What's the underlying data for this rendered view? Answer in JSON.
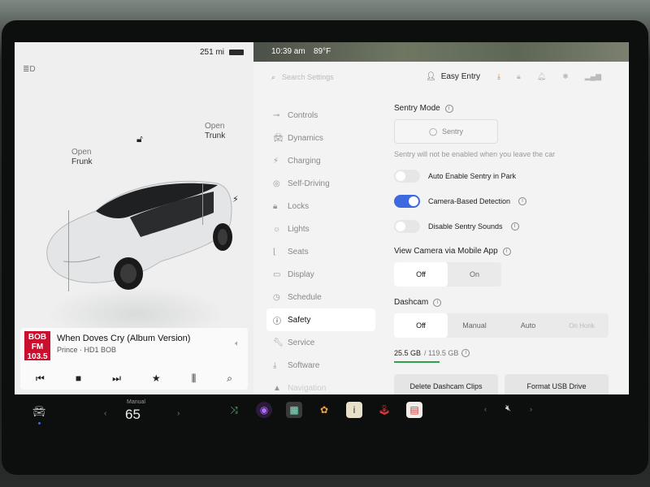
{
  "car": {
    "range": "251 mi",
    "frunk_open": "Open",
    "frunk_label": "Frunk",
    "trunk_open": "Open",
    "trunk_label": "Trunk"
  },
  "media": {
    "station_logo": "BOB FM 103.5",
    "song": "When Doves Cry (Album Version)",
    "artist": "Prince · HD1 BOB"
  },
  "status": {
    "time": "10:39 am",
    "temperature": "89°F"
  },
  "header": {
    "search_placeholder": "Search Settings",
    "profile": "Easy Entry"
  },
  "menu": [
    {
      "label": "Controls",
      "icon": "toggle-icon"
    },
    {
      "label": "Dynamics",
      "icon": "car-icon"
    },
    {
      "label": "Charging",
      "icon": "bolt-icon"
    },
    {
      "label": "Self-Driving",
      "icon": "wheel-icon"
    },
    {
      "label": "Locks",
      "icon": "lock-icon"
    },
    {
      "label": "Lights",
      "icon": "sun-icon"
    },
    {
      "label": "Seats",
      "icon": "seat-icon"
    },
    {
      "label": "Display",
      "icon": "display-icon"
    },
    {
      "label": "Schedule",
      "icon": "clock-icon"
    },
    {
      "label": "Safety",
      "icon": "alert-icon"
    },
    {
      "label": "Service",
      "icon": "wrench-icon"
    },
    {
      "label": "Software",
      "icon": "download-icon"
    },
    {
      "label": "Navigation",
      "icon": "navigation-icon"
    }
  ],
  "safety": {
    "sentry_title": "Sentry Mode",
    "sentry_button": "Sentry",
    "sentry_note": "Sentry will not be enabled when you leave the car",
    "toggles": {
      "auto_enable": "Auto Enable Sentry in Park",
      "camera_detection": "Camera-Based Detection",
      "disable_sounds": "Disable Sentry Sounds"
    },
    "camera_title": "View Camera via Mobile App",
    "camera_off": "Off",
    "camera_on": "On",
    "dashcam_title": "Dashcam",
    "dashcam_off": "Off",
    "dashcam_manual": "Manual",
    "dashcam_auto": "Auto",
    "dashcam_on_honk": "On Honk",
    "storage_used": "25.5 GB",
    "storage_total": "/ 119.5 GB",
    "delete_button": "Delete Dashcam Clips",
    "format_button": "Format USB Drive"
  },
  "dock": {
    "climate_mode": "Manual",
    "climate_temp": "65"
  },
  "colors": {
    "accent": "#3e6ae1",
    "download": "#e57a1f",
    "storage_bar": "#31a24c"
  }
}
